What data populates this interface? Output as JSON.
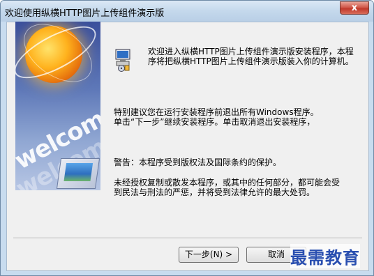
{
  "window": {
    "title": "欢迎使用纵横HTTP图片上传组件演示版",
    "close_label": "x"
  },
  "banner": {
    "word": "welcom",
    "word_ghost": "welcom"
  },
  "content": {
    "intro": "欢迎进入纵横HTTP图片上传组件演示版安装程序，本程序将把纵横HTTP图片上传组件演示版装入你的计算机。",
    "advice": "特别建议您在运行安装程序前退出所有Windows程序。\n单击“下一步”继续安装程序。单击取消退出安装程序，",
    "warning": "警告：本程序受到版权法及国际条约的保护。",
    "legal": "未经授权复制或散发本程序，或其中的任何部分，都可能会受到民法与刑法的严惩，并将受到法律允许的最大处罚。"
  },
  "buttons": {
    "next_label": "下一步(N) >",
    "cancel_label": "取消"
  },
  "watermark": "最需教育"
}
